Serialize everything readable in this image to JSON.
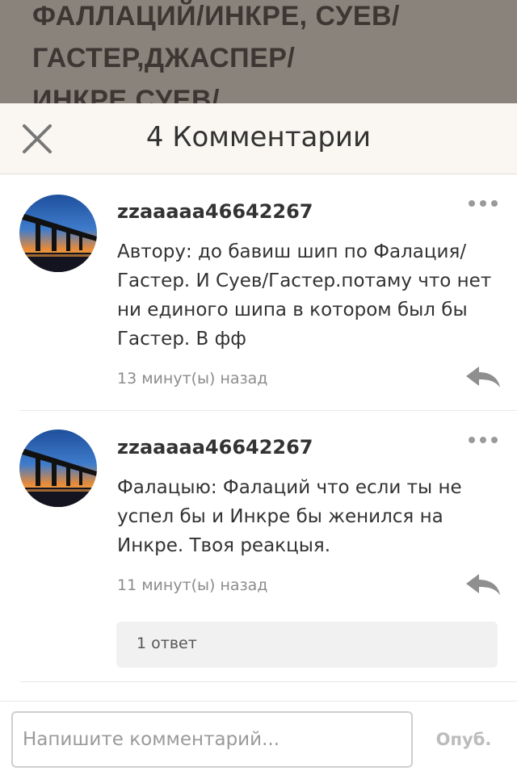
{
  "background_title": "ФАЛЛАЦИЙ/ИНКРЕ, СУЕВ/ ГАСТЕР,ДЖАСПЕР/ ИНКРЕ,СУЕВ/",
  "header": {
    "title": "4 Комментарии",
    "close_icon": "close-x-icon"
  },
  "comments": [
    {
      "username": "zzaaaaa46642267",
      "text": "Автору: до бавиш шип по Фалация/ Гастер. И Суев/Гастер.потаму что нет ни единого шипа в котором был бы Гастер. В фф",
      "time": "13 минут(ы) назад",
      "more_icon": "more-dots-icon",
      "reply_icon": "reply-arrow-icon"
    },
    {
      "username": "zzaaaaa46642267",
      "text": "Фалацыю: Фалаций что если ты не успел бы и Инкре бы женился на Инкре. Твоя реакцыя.",
      "time": "11 минут(ы) назад",
      "more_icon": "more-dots-icon",
      "reply_icon": "reply-arrow-icon",
      "replies_label": "1 ответ"
    }
  ],
  "footer": {
    "input_placeholder": "Напишите комментарий...",
    "publish_label": "Опуб."
  },
  "colors": {
    "header_bg": "#faf7f3",
    "overlay_bg": "#8a837c",
    "icon_gray": "#9a9a9a",
    "publish_disabled": "#bcbcbc"
  }
}
